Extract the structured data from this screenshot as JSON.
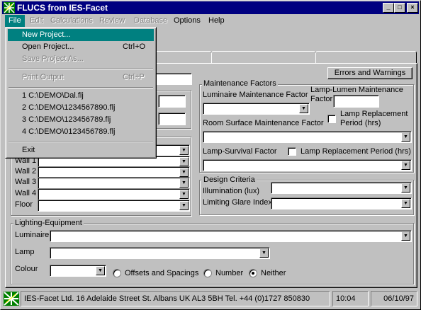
{
  "window": {
    "title": "FLUCS from IES-Facet",
    "controls": {
      "minimize": "_",
      "maximize": "□",
      "close": "×"
    }
  },
  "menubar": {
    "items": [
      {
        "label": "File",
        "enabled": true
      },
      {
        "label": "Edit",
        "enabled": false
      },
      {
        "label": "Calculations",
        "enabled": false
      },
      {
        "label": "Review",
        "enabled": false
      },
      {
        "label": "Database",
        "enabled": false
      },
      {
        "label": "Options",
        "enabled": true
      },
      {
        "label": "Help",
        "enabled": true
      }
    ]
  },
  "file_menu": {
    "items": [
      {
        "label": "New Project...",
        "shortcut": "",
        "selected": true
      },
      {
        "label": "Open Project...",
        "shortcut": "Ctrl+O"
      },
      {
        "label": "Save Project As...",
        "shortcut": "",
        "enabled": false
      },
      {
        "label": "Print Output",
        "shortcut": "Ctrl+P",
        "enabled": false
      },
      {
        "label": "1 C:\\DEMO\\Dal.flj"
      },
      {
        "label": "2 C:\\DEMO\\1234567890.flj"
      },
      {
        "label": "3 C:\\DEMO\\123456789.flj"
      },
      {
        "label": "4 C:\\DEMO\\0123456789.flj"
      },
      {
        "label": "Exit"
      }
    ]
  },
  "errors_button": "Errors and Warnings",
  "surfaces": {
    "labels": [
      "Wall 1",
      "Wall 2",
      "Wall 3",
      "Wall 4",
      "Floor"
    ]
  },
  "maintenance": {
    "title": "Maintenance Factors",
    "luminaire_mf": "Luminaire Maintenance Factor",
    "lamp_lumen_mf_line1": "Lamp-Lumen Maintenance",
    "lamp_lumen_mf_line2": "Factor",
    "lamp_replacement_line1": "Lamp Replacement",
    "lamp_replacement_line2": "Period (hrs)",
    "room_surface_mf": "Room Surface Maintenance Factor",
    "lamp_survival": "Lamp-Survival Factor",
    "lamp_replacement_2": "Lamp Replacement Period (hrs)"
  },
  "design": {
    "title": "Design Criteria",
    "illumination": "Illumination (lux)",
    "glare": "Limiting Glare Index"
  },
  "lighting": {
    "title": "Lighting-Equipment",
    "luminaire": "Luminaire",
    "lamp": "Lamp",
    "colour": "Colour",
    "options": [
      {
        "label": "Offsets and Spacings",
        "checked": false
      },
      {
        "label": "Number",
        "checked": false
      },
      {
        "label": "Neither",
        "checked": true
      }
    ]
  },
  "statusbar": {
    "company": "IES-Facet Ltd. 16 Adelaide Street St. Albans UK AL3 5BH Tel. +44 (0)1727 850830",
    "time": "10:04",
    "date": "06/10/97"
  }
}
